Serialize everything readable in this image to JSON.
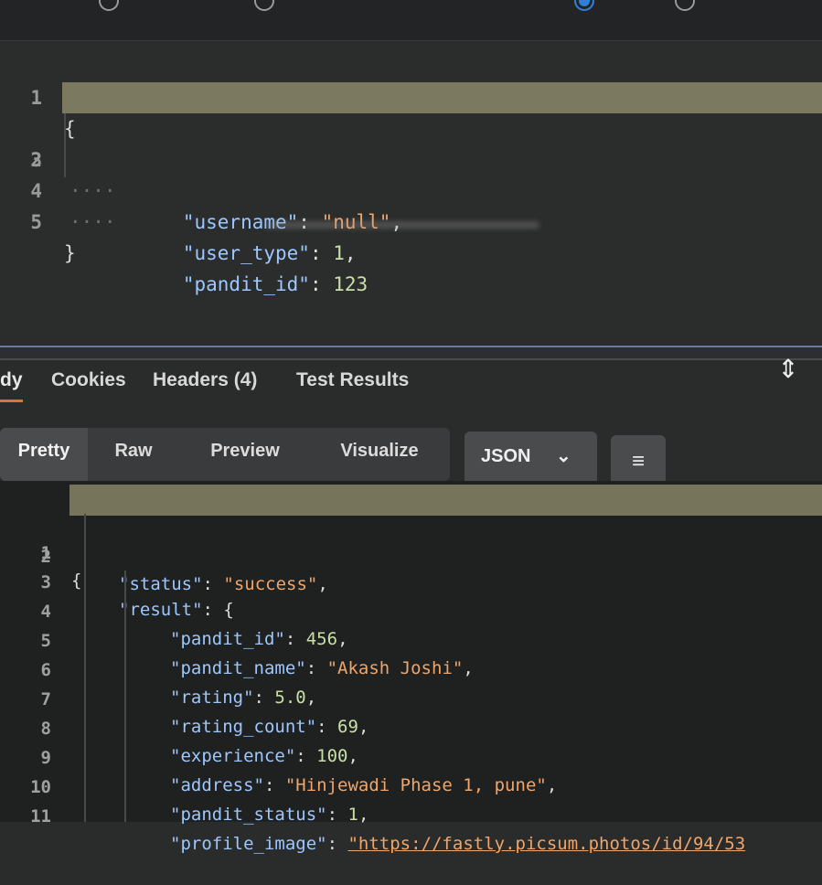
{
  "request": {
    "lines": [
      {
        "n": "1",
        "text": "{"
      },
      {
        "n": "2",
        "key": "\"username\"",
        "value": "\"null\"",
        "tail": ","
      },
      {
        "n": "3",
        "key": "\"user_type\"",
        "value": "1",
        "tail": ","
      },
      {
        "n": "4",
        "key": "\"pandit_id\"",
        "value": "123",
        "tail": ""
      },
      {
        "n": "5",
        "text": "}"
      }
    ]
  },
  "response_tabs": [
    "dy",
    "Cookies",
    "Headers (4)",
    "Test Results"
  ],
  "view": {
    "buttons": [
      "Pretty",
      "Raw",
      "Preview",
      "Visualize"
    ],
    "format": "JSON",
    "wrap_icon": "wrap-lines-icon"
  },
  "response": {
    "lines": [
      {
        "n": "1",
        "text": "{"
      },
      {
        "n": "2",
        "key": "\"status\"",
        "value": "\"success\"",
        "tail": ","
      },
      {
        "n": "3",
        "key": "\"result\"",
        "value": "{",
        "tail": ""
      },
      {
        "n": "4",
        "key": "\"pandit_id\"",
        "value": "456",
        "tail": ","
      },
      {
        "n": "5",
        "key": "\"pandit_name\"",
        "value": "\"Akash Joshi\"",
        "tail": ","
      },
      {
        "n": "6",
        "key": "\"rating\"",
        "value": "5.0",
        "tail": ","
      },
      {
        "n": "7",
        "key": "\"rating_count\"",
        "value": "69",
        "tail": ","
      },
      {
        "n": "8",
        "key": "\"experience\"",
        "value": "100",
        "tail": ","
      },
      {
        "n": "9",
        "key": "\"address\"",
        "value": "\"Hinjewadi Phase 1, pune\"",
        "tail": ","
      },
      {
        "n": "10",
        "key": "\"pandit_status\"",
        "value": "1",
        "tail": ","
      },
      {
        "n": "11",
        "key": "\"profile_image\"",
        "value": "\"https://fastly.picsum.photos/id/94/53",
        "tail": ""
      }
    ]
  },
  "colors": {
    "key": "#9cc7ff",
    "string": "#f0a56a",
    "number": "#c8e0a8",
    "active_tab": "#e0703a"
  }
}
